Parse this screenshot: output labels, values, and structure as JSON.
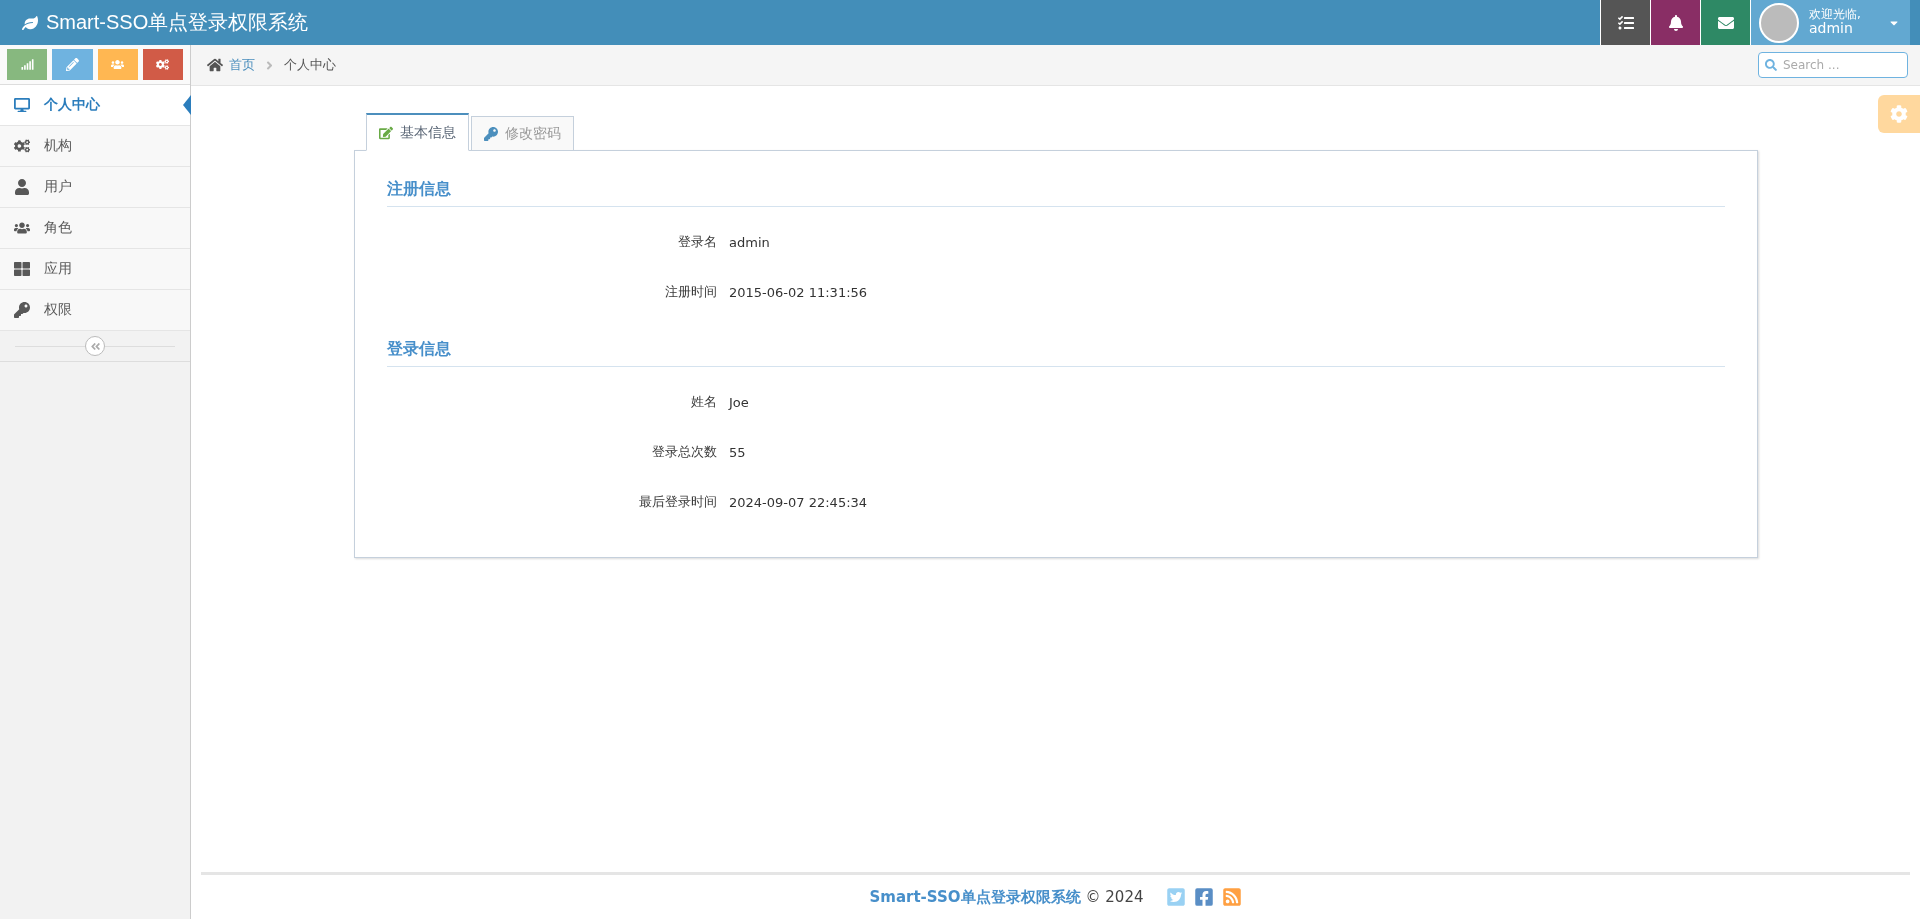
{
  "header": {
    "title": "Smart-SSO单点登录权限系统",
    "user": {
      "greeting": "欢迎光临,",
      "name": "admin"
    }
  },
  "shortcuts": [
    {
      "color": "#87b87f"
    },
    {
      "color": "#6fb3e0"
    },
    {
      "color": "#ffb752"
    },
    {
      "color": "#d15b47"
    }
  ],
  "sidebar": {
    "items": [
      {
        "label": "个人中心",
        "selected": true
      },
      {
        "label": "机构",
        "selected": false
      },
      {
        "label": "用户",
        "selected": false
      },
      {
        "label": "角色",
        "selected": false
      },
      {
        "label": "应用",
        "selected": false
      },
      {
        "label": "权限",
        "selected": false
      }
    ]
  },
  "breadcrumb": [
    "首页",
    "个人中心"
  ],
  "search": {
    "placeholder": "Search ..."
  },
  "tabs": [
    {
      "label": "基本信息",
      "selected": true
    },
    {
      "label": "修改密码",
      "selected": false
    }
  ],
  "sections": [
    {
      "title": "注册信息",
      "fields": [
        {
          "label": "登录名",
          "value": "admin"
        },
        {
          "label": "注册时间",
          "value": "2015-06-02 11:31:56"
        }
      ]
    },
    {
      "title": "登录信息",
      "fields": [
        {
          "label": "姓名",
          "value": "Joe"
        },
        {
          "label": "登录总次数",
          "value": "55"
        },
        {
          "label": "最后登录时间",
          "value": "2024-09-07 22:45:34"
        }
      ]
    }
  ],
  "footer": {
    "brand": "Smart-SSO单点登录权限系统",
    "copyright": "© 2024"
  }
}
